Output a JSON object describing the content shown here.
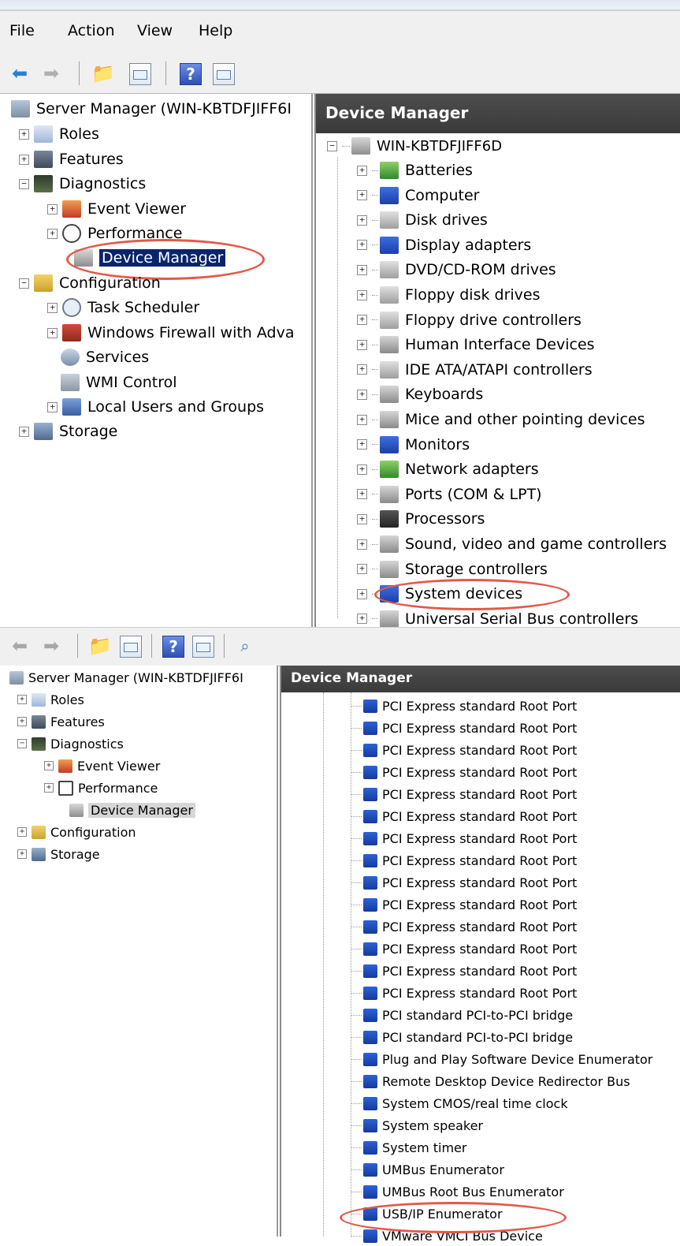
{
  "menu": [
    "File",
    "Action",
    "View",
    "Help"
  ],
  "top": {
    "left_tree": {
      "root": "Server Manager (WIN-KBTDFJIFF6I",
      "roles": "Roles",
      "features": "Features",
      "diagnostics": "Diagnostics",
      "event_viewer": "Event Viewer",
      "performance": "Performance",
      "device_manager": "Device Manager",
      "configuration": "Configuration",
      "task_scheduler": "Task Scheduler",
      "firewall": "Windows Firewall with Adva",
      "services": "Services",
      "wmi": "WMI Control",
      "local_users": "Local Users and Groups",
      "storage": "Storage"
    },
    "right_header": "Device Manager",
    "computer": "WIN-KBTDFJIFF6D",
    "categories": [
      "Batteries",
      "Computer",
      "Disk drives",
      "Display adapters",
      "DVD/CD-ROM drives",
      "Floppy disk drives",
      "Floppy drive controllers",
      "Human Interface Devices",
      "IDE ATA/ATAPI controllers",
      "Keyboards",
      "Mice and other pointing devices",
      "Monitors",
      "Network adapters",
      "Ports (COM & LPT)",
      "Processors",
      "Sound, video and game controllers",
      "Storage controllers",
      "System devices",
      "Universal Serial Bus controllers"
    ]
  },
  "bottom": {
    "left_tree": {
      "root": "Server Manager (WIN-KBTDFJIFF6I",
      "roles": "Roles",
      "features": "Features",
      "diagnostics": "Diagnostics",
      "event_viewer": "Event Viewer",
      "performance": "Performance",
      "device_manager": "Device Manager",
      "configuration": "Configuration",
      "storage": "Storage"
    },
    "right_header": "Device Manager",
    "devices": [
      "PCI Express standard Root Port",
      "PCI Express standard Root Port",
      "PCI Express standard Root Port",
      "PCI Express standard Root Port",
      "PCI Express standard Root Port",
      "PCI Express standard Root Port",
      "PCI Express standard Root Port",
      "PCI Express standard Root Port",
      "PCI Express standard Root Port",
      "PCI Express standard Root Port",
      "PCI Express standard Root Port",
      "PCI Express standard Root Port",
      "PCI Express standard Root Port",
      "PCI Express standard Root Port",
      "PCI standard PCI-to-PCI bridge",
      "PCI standard PCI-to-PCI bridge",
      "Plug and Play Software Device Enumerator",
      "Remote Desktop Device Redirector Bus",
      "System CMOS/real time clock",
      "System speaker",
      "System timer",
      "UMBus Enumerator",
      "UMBus Root Bus Enumerator",
      "USB/IP Enumerator",
      "VMware VMCI Bus Device"
    ]
  },
  "colors": {
    "highlight_oval": "#e25a4a",
    "selection": "#0a246a",
    "header": "#3f3f3f"
  }
}
